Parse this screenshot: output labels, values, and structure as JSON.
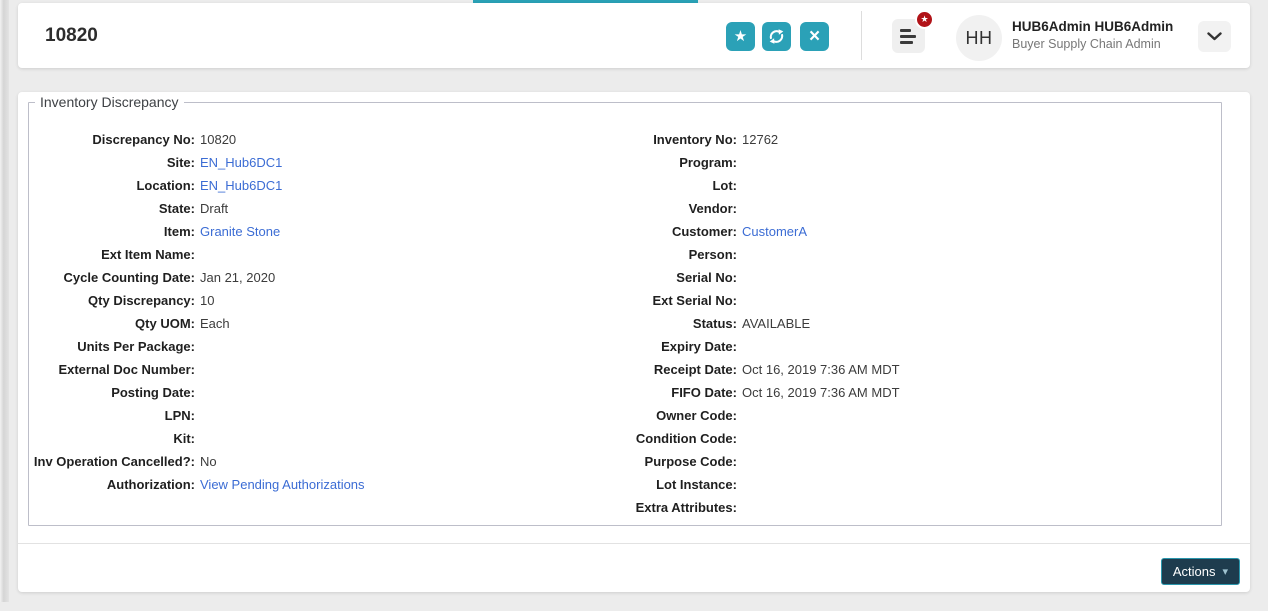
{
  "header": {
    "title": "10820",
    "glyphs": {
      "favorite": "★",
      "close": "×",
      "badge_star": "★",
      "caret": "▾"
    },
    "user": {
      "initials": "HH",
      "name": "HUB6Admin HUB6Admin",
      "role": "Buyer Supply Chain Admin"
    }
  },
  "panel": {
    "legend": "Inventory Discrepancy",
    "left_fields": [
      {
        "label": "Discrepancy No",
        "value": "10820",
        "link": false
      },
      {
        "label": "Site",
        "value": "EN_Hub6DC1",
        "link": true
      },
      {
        "label": "Location",
        "value": "EN_Hub6DC1",
        "link": true
      },
      {
        "label": "State",
        "value": "Draft",
        "link": false
      },
      {
        "label": "Item",
        "value": "Granite Stone",
        "link": true
      },
      {
        "label": "Ext Item Name",
        "value": "",
        "link": false
      },
      {
        "label": "Cycle Counting Date",
        "value": "Jan 21, 2020",
        "link": false
      },
      {
        "label": "Qty Discrepancy",
        "value": "10",
        "link": false
      },
      {
        "label": "Qty UOM",
        "value": "Each",
        "link": false
      },
      {
        "label": "Units Per Package",
        "value": "",
        "link": false
      },
      {
        "label": "External Doc Number",
        "value": "",
        "link": false
      },
      {
        "label": "Posting Date",
        "value": "",
        "link": false
      },
      {
        "label": "LPN",
        "value": "",
        "link": false
      },
      {
        "label": "Kit",
        "value": "",
        "link": false
      },
      {
        "label": "Inv Operation Cancelled?",
        "value": "No",
        "link": false
      },
      {
        "label": "Authorization",
        "value": "View Pending Authorizations",
        "link": true
      }
    ],
    "right_fields": [
      {
        "label": "Inventory No",
        "value": "12762",
        "link": false
      },
      {
        "label": "Program",
        "value": "",
        "link": false
      },
      {
        "label": "Lot",
        "value": "",
        "link": false
      },
      {
        "label": "Vendor",
        "value": "",
        "link": false
      },
      {
        "label": "Customer",
        "value": "CustomerA",
        "link": true
      },
      {
        "label": "Person",
        "value": "",
        "link": false
      },
      {
        "label": "Serial No",
        "value": "",
        "link": false
      },
      {
        "label": "Ext Serial No",
        "value": "",
        "link": false
      },
      {
        "label": "Status",
        "value": "AVAILABLE",
        "link": false
      },
      {
        "label": "Expiry Date",
        "value": "",
        "link": false
      },
      {
        "label": "Receipt Date",
        "value": "Oct 16, 2019 7:36 AM MDT",
        "link": false
      },
      {
        "label": "FIFO Date",
        "value": "Oct 16, 2019 7:36 AM MDT",
        "link": false
      },
      {
        "label": "Owner Code",
        "value": "",
        "link": false
      },
      {
        "label": "Condition Code",
        "value": "",
        "link": false
      },
      {
        "label": "Purpose Code",
        "value": "",
        "link": false
      },
      {
        "label": "Lot Instance",
        "value": "",
        "link": false
      },
      {
        "label": "Extra Attributes",
        "value": "",
        "link": false
      }
    ]
  },
  "footer": {
    "actions_label": "Actions"
  },
  "colors": {
    "accent_teal": "#2ba1b7",
    "tab_bar_teal": "#2aa1b6",
    "link_blue": "#3b6cd4",
    "badge_red": "#b11318",
    "actions_bg": "#1e3c4e",
    "actions_border": "#2a96ac",
    "page_bg": "#ececec"
  }
}
